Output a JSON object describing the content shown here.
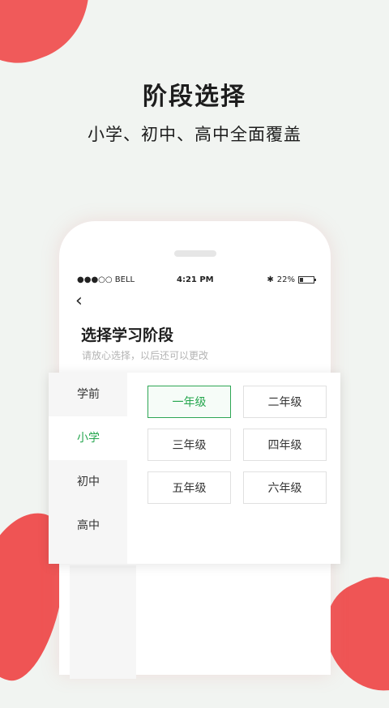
{
  "banner": {
    "title": "阶段选择",
    "subtitle": "小学、初中、高中全面覆盖"
  },
  "status_bar": {
    "carrier": "●●●○○ BELL",
    "time": "4:21 PM",
    "battery": "22%"
  },
  "screen": {
    "back_label": "‹",
    "title": "选择学习阶段",
    "hint": "请放心选择，以后还可以更改"
  },
  "categories": [
    "学前",
    "小学",
    "初中",
    "高中"
  ],
  "active_category": "小学",
  "grades": [
    "一年级",
    "二年级",
    "三年级",
    "四年级",
    "五年级",
    "六年级"
  ],
  "selected_grade": "一年级",
  "colors": {
    "accent_green": "#25a64e",
    "blob_red": "#ef5454",
    "background": "#f1f4f1"
  }
}
